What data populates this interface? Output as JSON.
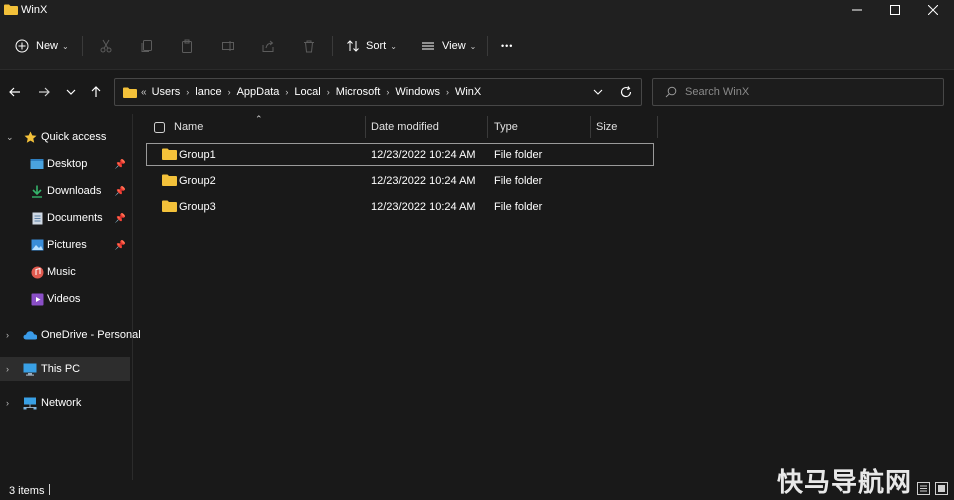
{
  "window": {
    "title": "WinX"
  },
  "toolbar": {
    "new_label": "New",
    "sort_label": "Sort",
    "view_label": "View",
    "more_label": "•••"
  },
  "address": {
    "overflow": "«",
    "crumbs": [
      "Users",
      "lance",
      "AppData",
      "Local",
      "Microsoft",
      "Windows",
      "WinX"
    ]
  },
  "search": {
    "placeholder": "Search WinX"
  },
  "sidebar": {
    "quick_access": "Quick access",
    "items": [
      {
        "label": "Desktop",
        "icon": "desktop-icon",
        "pinned": true
      },
      {
        "label": "Downloads",
        "icon": "downloads-icon",
        "pinned": true
      },
      {
        "label": "Documents",
        "icon": "documents-icon",
        "pinned": true
      },
      {
        "label": "Pictures",
        "icon": "pictures-icon",
        "pinned": true
      },
      {
        "label": "Music",
        "icon": "music-icon",
        "pinned": false
      },
      {
        "label": "Videos",
        "icon": "videos-icon",
        "pinned": false
      }
    ],
    "onedrive": "OneDrive - Personal",
    "this_pc": "This PC",
    "network": "Network"
  },
  "columns": {
    "name": "Name",
    "date": "Date modified",
    "type": "Type",
    "size": "Size"
  },
  "files": [
    {
      "name": "Group1",
      "date": "12/23/2022 10:24 AM",
      "type": "File folder",
      "size": ""
    },
    {
      "name": "Group2",
      "date": "12/23/2022 10:24 AM",
      "type": "File folder",
      "size": ""
    },
    {
      "name": "Group3",
      "date": "12/23/2022 10:24 AM",
      "type": "File folder",
      "size": ""
    }
  ],
  "status": {
    "item_count": "3 items"
  },
  "watermark": "快马导航网",
  "colors": {
    "folder": "#f3c13a",
    "accent": "#4cc2ff"
  }
}
